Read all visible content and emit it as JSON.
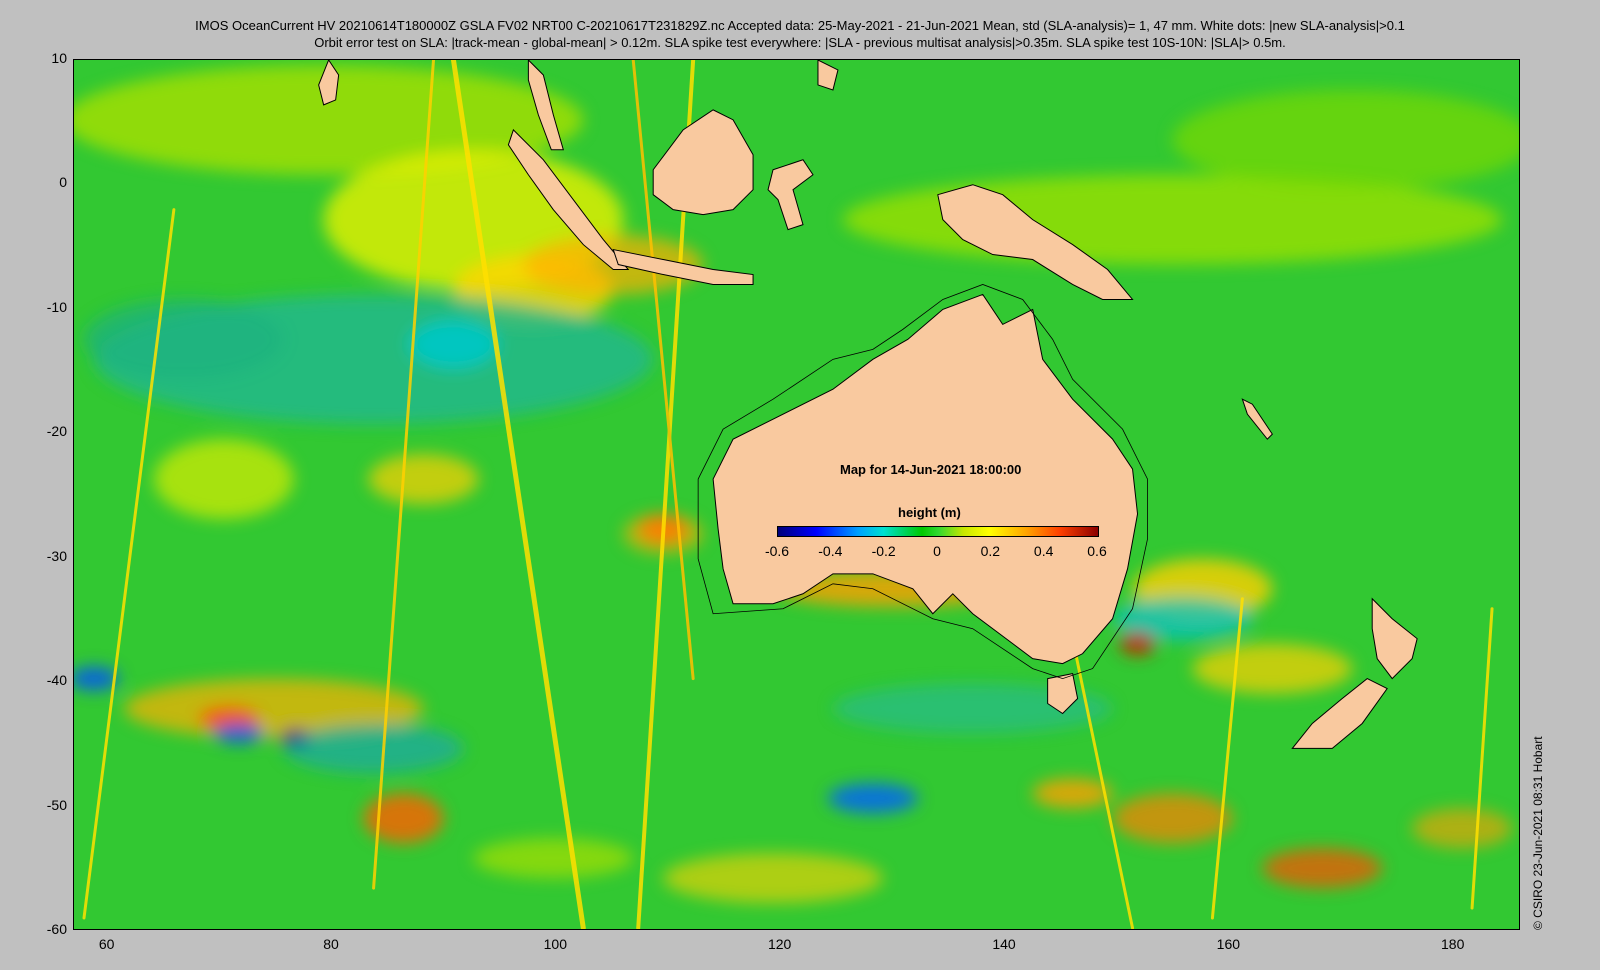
{
  "header": {
    "title_line1": "IMOS OceanCurrent HV 20210614T180000Z GSLA FV02 NRT00 C-20210617T231829Z.nc  Accepted data: 25-May-2021 - 21-Jun-2021 Mean, std (SLA-analysis)= 1, 47 mm. White dots: |new SLA-analysis|>0.1",
    "title_line2": "Orbit error test on SLA: |track-mean  - global-mean| > 0.12m.  SLA spike test everywhere: |SLA - previous multisat analysis|>0.35m. SLA spike test 10S-10N: |SLA|> 0.5m."
  },
  "map": {
    "lon_range": [
      57,
      186
    ],
    "lat_range": [
      -60,
      10
    ],
    "x_ticks": [
      60,
      80,
      100,
      120,
      140,
      160,
      180
    ],
    "y_ticks": [
      10,
      0,
      -10,
      -20,
      -30,
      -40,
      -50,
      -60
    ],
    "land_color": "#f9c99f",
    "ocean_base_color": "#32c832",
    "date_label": "Map for 14-Jun-2021 18:00:00"
  },
  "legend": {
    "title": "height (m)",
    "ticks": [
      "-0.6",
      "-0.4",
      "-0.2",
      "0",
      "0.2",
      "0.4",
      "0.6"
    ],
    "range": [
      -0.6,
      0.6
    ],
    "colormap": [
      "#00007a",
      "#0000ff",
      "#00a0ff",
      "#00e0d0",
      "#00c800",
      "#c8e600",
      "#ffff00",
      "#ffa000",
      "#ff4000",
      "#8b0000"
    ]
  },
  "credit": "©  CSIRO 23-Jun-2021 08:31 Hobart"
}
